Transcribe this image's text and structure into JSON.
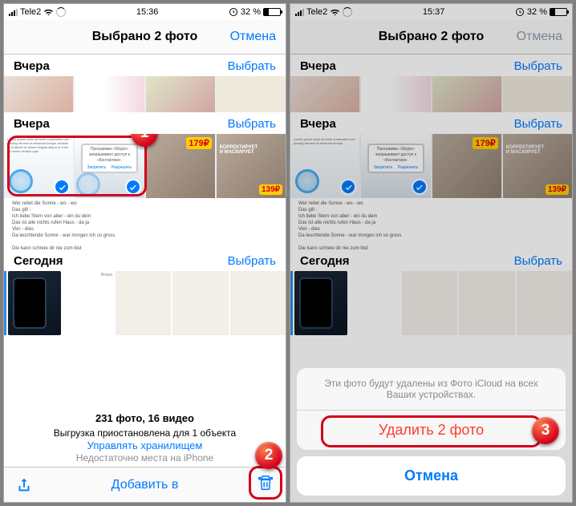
{
  "status": {
    "carrier": "Tele2",
    "time_left": "15:36",
    "time_right": "15:37",
    "battery_pct": "32 %"
  },
  "nav": {
    "title": "Выбрано 2 фото",
    "cancel": "Отмена"
  },
  "sections": {
    "yesterday": "Вчера",
    "today": "Сегодня",
    "select": "Выбрать"
  },
  "prices": {
    "p1": "179₽",
    "p2": "139₽"
  },
  "footer": {
    "summary": "231 фото, 16 видео",
    "pause": "Выгрузка приостановлена для 1 объекта",
    "manage": "Управлять хранилищем",
    "nospace": "Недостаточно места на iPhone"
  },
  "toolbar": {
    "add": "Добавить в"
  },
  "sheet": {
    "msg": "Эти фото будут удалены из Фото iCloud на всех Ваших устройствах.",
    "delete": "Удалить 2 фото",
    "cancel": "Отмена"
  },
  "badges": {
    "b1": "1",
    "b2": "2",
    "b3": "3"
  }
}
